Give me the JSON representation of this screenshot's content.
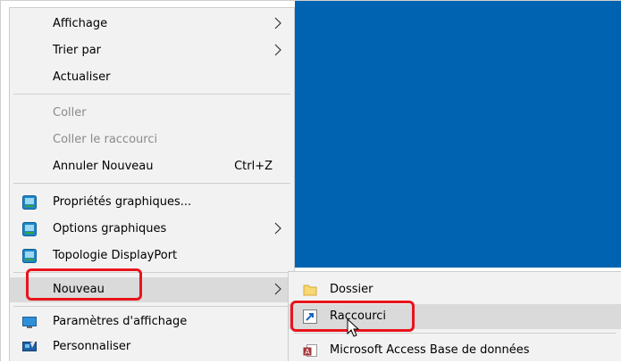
{
  "context_menu": {
    "items": [
      {
        "label": "Affichage",
        "has_submenu": true
      },
      {
        "label": "Trier par",
        "has_submenu": true
      },
      {
        "label": "Actualiser"
      },
      {
        "label": "Coller",
        "disabled": true
      },
      {
        "label": "Coller le raccourci",
        "disabled": true
      },
      {
        "label": "Annuler Nouveau",
        "shortcut": "Ctrl+Z"
      },
      {
        "label": "Propriétés graphiques...",
        "icon": "intel-graphics-icon"
      },
      {
        "label": "Options graphiques",
        "icon": "intel-graphics-icon",
        "has_submenu": true
      },
      {
        "label": "Topologie DisplayPort",
        "icon": "intel-graphics-icon"
      },
      {
        "label": "Nouveau",
        "has_submenu": true,
        "highlighted": true
      },
      {
        "label": "Paramètres d'affichage",
        "icon": "display-icon"
      },
      {
        "label": "Personnaliser",
        "icon": "personalize-icon"
      }
    ]
  },
  "submenu": {
    "items": [
      {
        "label": "Dossier",
        "icon": "folder-icon"
      },
      {
        "label": "Raccourci",
        "icon": "shortcut-icon",
        "highlighted": true
      },
      {
        "label": "Microsoft Access Base de données",
        "icon": "access-icon"
      }
    ]
  },
  "colors": {
    "desktop": "#0063b1",
    "menu_bg": "#f2f2f2",
    "hover_bg": "#dadada",
    "highlight_box": "#e8141c"
  }
}
